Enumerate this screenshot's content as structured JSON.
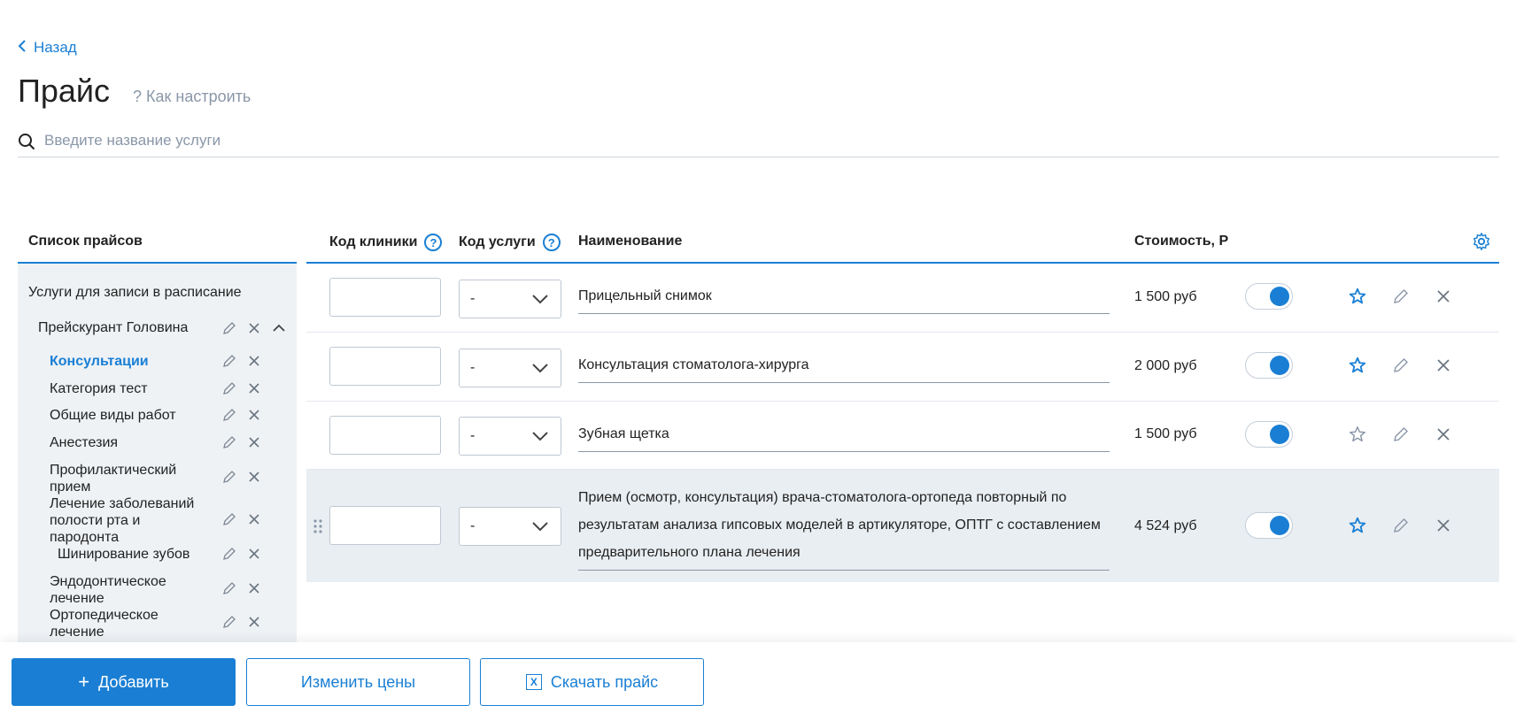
{
  "nav": {
    "back_label": "Назад"
  },
  "header": {
    "title": "Прайс",
    "howto_label": "? Как настроить"
  },
  "search": {
    "placeholder": "Введите название услуги"
  },
  "sidebar": {
    "title": "Список прайсов",
    "root_label": "Услуги для записи в расписание",
    "pricelist_label": "Прейскурант Головина",
    "categories": [
      {
        "label": "Консультации",
        "active": true
      },
      {
        "label": "Категория тест"
      },
      {
        "label": "Общие виды работ"
      },
      {
        "label": "Анестезия"
      },
      {
        "label": "Профилактический прием"
      },
      {
        "label": "Лечение заболеваний полости рта и пародонта"
      },
      {
        "label": "Шинирование зубов"
      },
      {
        "label": "Эндодонтическое лечение"
      },
      {
        "label": "Ортопедическое лечение"
      }
    ]
  },
  "table": {
    "headers": {
      "clinic_code": "Код клиники",
      "service_code": "Код услуги",
      "name": "Наименование",
      "price": "Стоимость, Р"
    },
    "rows": [
      {
        "clinic_code": "",
        "service_code": "-",
        "name": "Прицельный снимок",
        "price": "1 500 руб",
        "enabled": true,
        "favorite": true
      },
      {
        "clinic_code": "",
        "service_code": "-",
        "name": "Консультация стоматолога-хирурга",
        "price": "2 000 руб",
        "enabled": true,
        "favorite": true
      },
      {
        "clinic_code": "",
        "service_code": "-",
        "name": "Зубная щетка",
        "price": "1 500 руб",
        "enabled": true,
        "favorite": false
      },
      {
        "clinic_code": "",
        "service_code": "-",
        "name": "Прием (осмотр, консультация) врача-стоматолога-ортопеда повторный по результатам анализа гипсовых моделей в артикуляторе, ОПТГ с составлением предварительного плана лечения",
        "price": "4 524 руб",
        "enabled": true,
        "favorite": true
      }
    ]
  },
  "footer": {
    "add_label": "Добавить",
    "change_prices_label": "Изменить цены",
    "download_label": "Скачать прайс"
  },
  "colors": {
    "accent": "#1a7fd4",
    "panel_bg": "#eef2f5",
    "row_highlight": "#e9eef2",
    "muted_text": "#8a97a8"
  }
}
